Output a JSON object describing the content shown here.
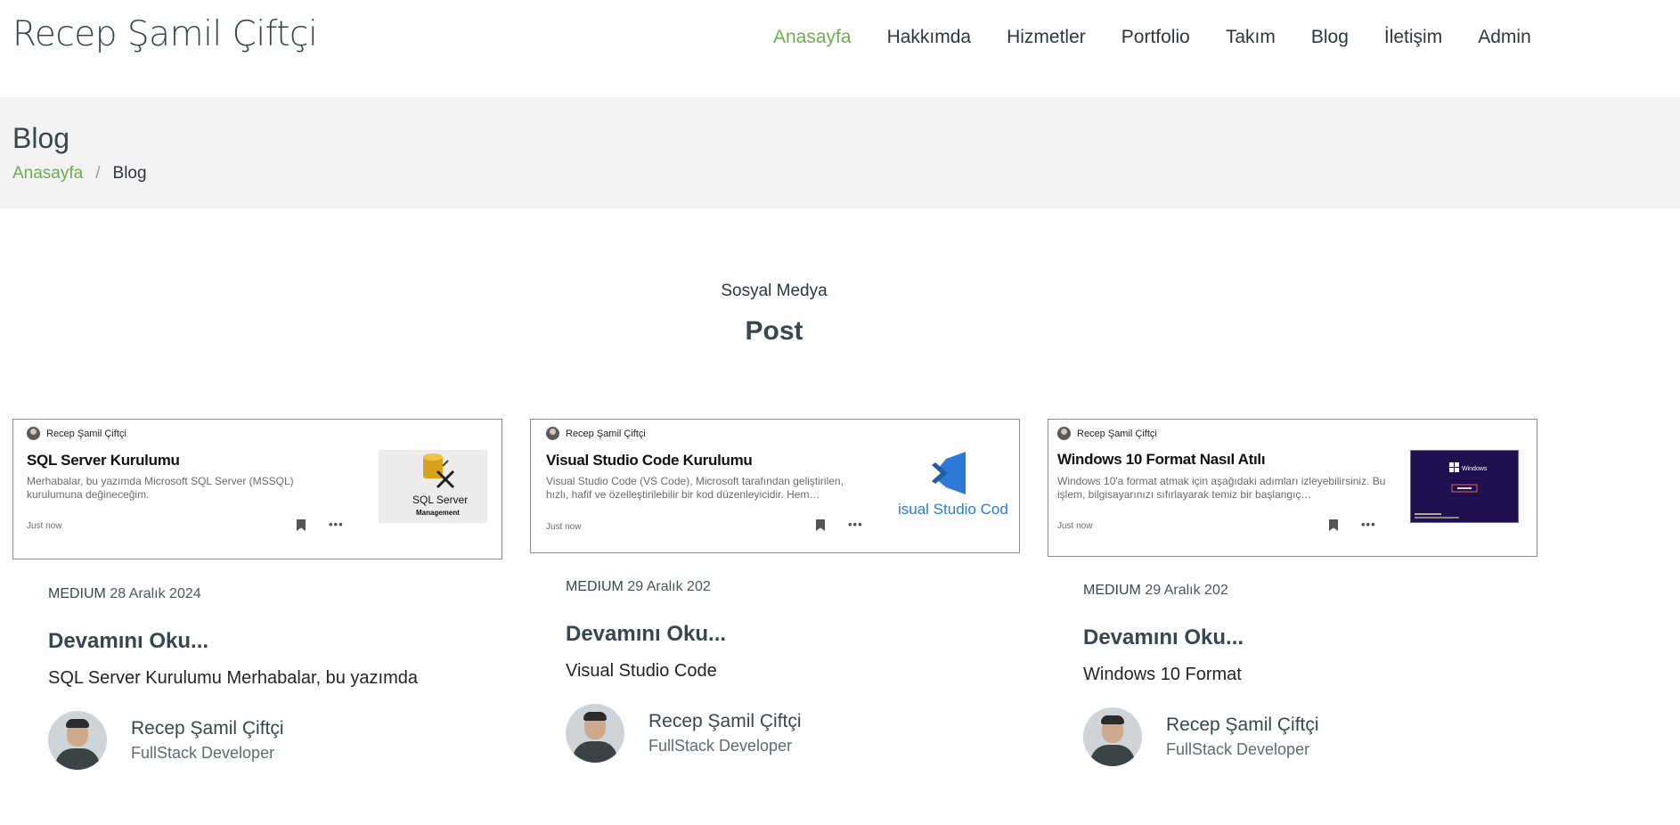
{
  "brand": "Recep Şamil Çiftçi",
  "nav": [
    {
      "label": "Anasayfa"
    },
    {
      "label": "Hakkımda"
    },
    {
      "label": "Hizmetler"
    },
    {
      "label": "Portfolio"
    },
    {
      "label": "Takım"
    },
    {
      "label": "Blog"
    },
    {
      "label": "İletişim"
    },
    {
      "label": "Admin"
    }
  ],
  "page_header": {
    "title": "Blog",
    "breadcrumb": {
      "home": "Anasayfa",
      "separator": "/",
      "current": "Blog"
    }
  },
  "section": {
    "subtitle": "Sosyal Medya",
    "title": "Post"
  },
  "posts": [
    {
      "embed": {
        "author": "Recep Şamil Çiftçi",
        "title": "SQL Server Kurulumu",
        "desc": "Merhabalar, bu yazımda Microsoft SQL Server (MSSQL) kurulumuna değineceğim.",
        "time": "Just now",
        "more": "•••",
        "thumb_line1": "SQL Server",
        "thumb_line2": "Management"
      },
      "source": "MEDIUM",
      "date": "28 Aralık 2024",
      "read_more": "Devamını Oku...",
      "excerpt": "SQL Server Kurulumu Merhabalar, bu yazımda",
      "author_name": "Recep Şamil Çiftçi",
      "author_role": "FullStack Developer"
    },
    {
      "embed": {
        "author": "Recep Şamil Çiftçi",
        "title": "Visual Studio Code Kurulumu",
        "desc": "Visual Studio Code (VS Code), Microsoft tarafından geliştirilen, hızlı, hafif ve özelleştirilebilir bir kod düzenleyicidir. Hem…",
        "time": "Just now",
        "more": "•••",
        "thumb_text": "isual Studio Cod"
      },
      "source": "MEDIUM",
      "date": "29 Aralık 202",
      "read_more": "Devamını Oku...",
      "excerpt": "Visual Studio Code",
      "author_name": "Recep Şamil Çiftçi",
      "author_role": "FullStack Developer"
    },
    {
      "embed": {
        "author": "Recep Şamil Çiftçi",
        "title": "Windows 10 Format Nasıl Atılı",
        "desc": "Windows 10'a format atmak için aşağıdaki adımları izleyebilirsiniz. Bu işlem, bilgisayarınızı sıfırlayarak temiz bir başlangıç…",
        "time": "Just now",
        "more": "•••",
        "thumb_text": "Windows"
      },
      "source": "MEDIUM",
      "date": "29 Aralık 202",
      "read_more": "Devamını Oku...",
      "excerpt": "Windows 10 Format",
      "author_name": "Recep Şamil Çiftçi",
      "author_role": "FullStack Developer"
    }
  ],
  "colors": {
    "accent": "#6ab04c",
    "heading": "#37474f",
    "band": "#f3f3f3"
  }
}
